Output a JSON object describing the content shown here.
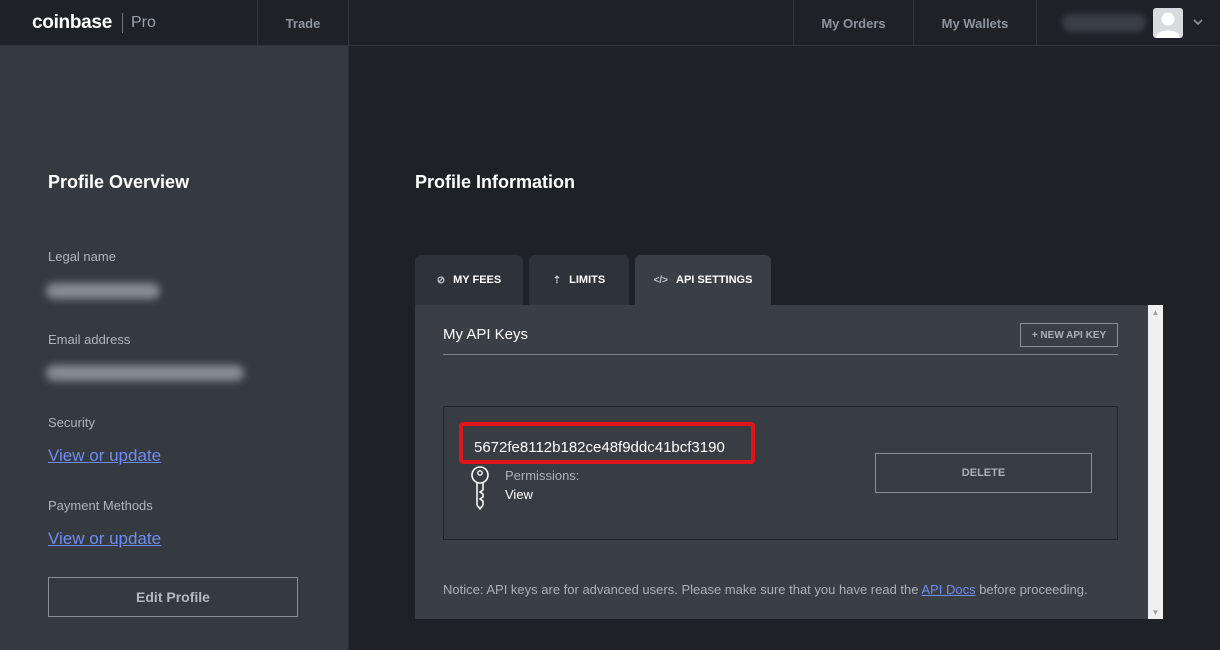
{
  "brand": {
    "name": "coinbase",
    "product": "Pro"
  },
  "nav": {
    "trade": "Trade",
    "my_orders": "My Orders",
    "my_wallets": "My Wallets"
  },
  "user": {
    "avatar_icon": "user-avatar-icon",
    "menu_icon": "chevron-down-icon"
  },
  "sidebar": {
    "title": "Profile Overview",
    "legal_name_label": "Legal name",
    "email_label": "Email address",
    "security_label": "Security",
    "security_link": "View or update",
    "payment_label": "Payment Methods",
    "payment_link": "View or update",
    "edit_button": "Edit Profile"
  },
  "main": {
    "title": "Profile Information",
    "tabs": [
      {
        "label": "MY FEES",
        "icon": "fees-icon",
        "glyph": "⊘"
      },
      {
        "label": "LIMITS",
        "icon": "upload-icon",
        "glyph": "⇡"
      },
      {
        "label": "API SETTINGS",
        "icon": "code-icon",
        "glyph": "</>",
        "active": true
      }
    ],
    "panel": {
      "title": "My API Keys",
      "new_key_button": "+ NEW API KEY",
      "key": {
        "value": "5672fe8112b182ce48f9ddc41bcf3190",
        "permissions_label": "Permissions:",
        "permissions_value": "View",
        "delete_button": "DELETE"
      },
      "notice_prefix": "Notice: API keys are for advanced users. Please make sure that you have read the ",
      "notice_link": "API Docs",
      "notice_suffix": " before proceeding."
    }
  },
  "colors": {
    "background": "#1e2126",
    "sidebar": "#353a41",
    "panel": "#3a3f46",
    "link": "#6f8df0",
    "highlight": "#e0141b"
  }
}
